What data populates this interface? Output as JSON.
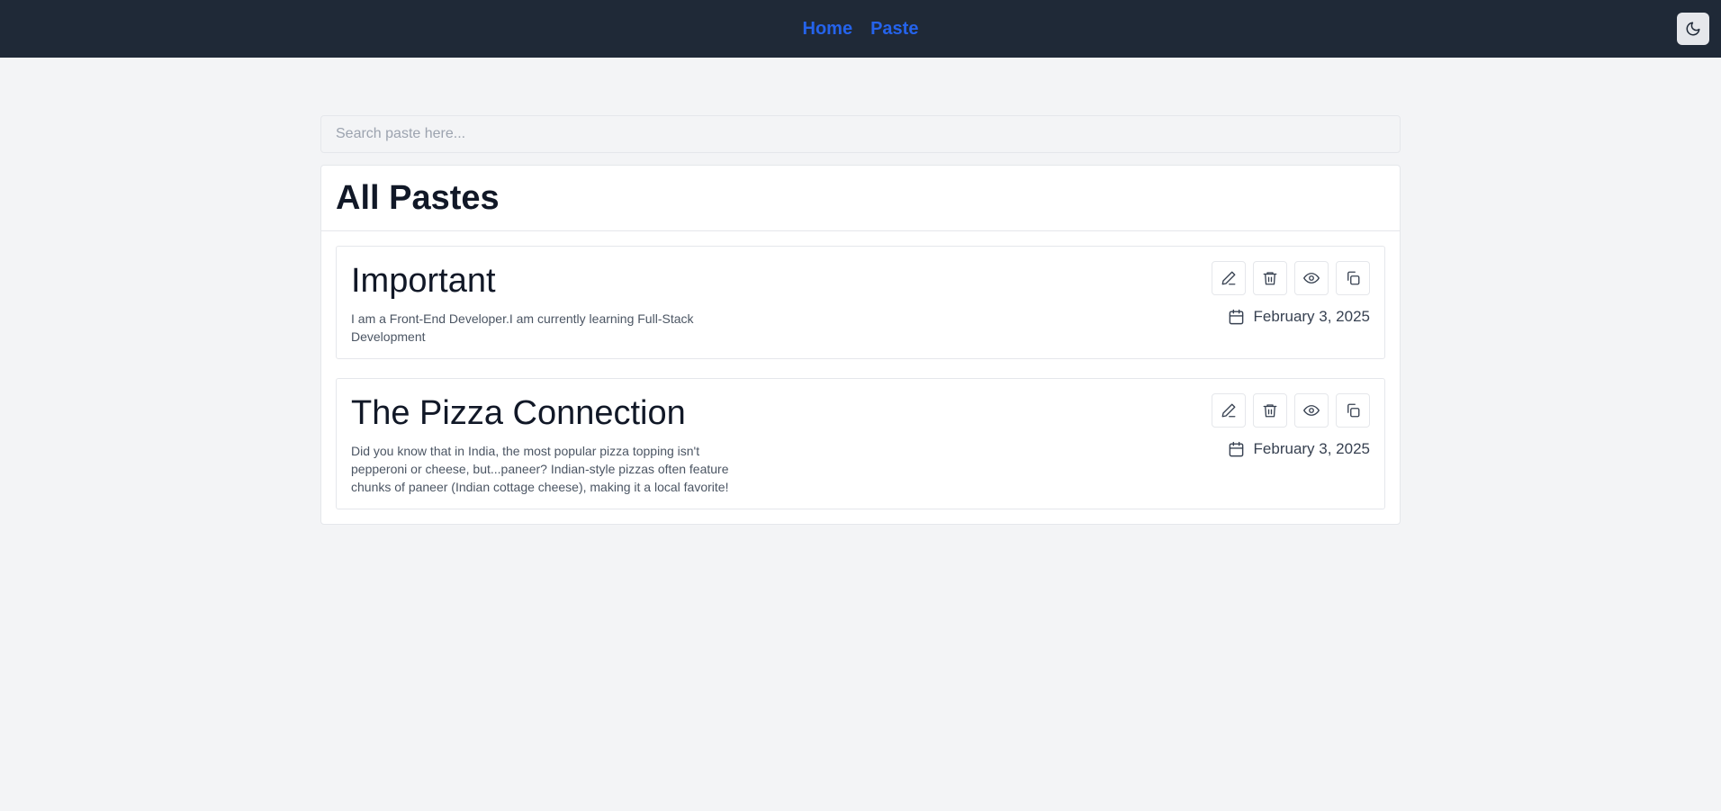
{
  "nav": {
    "links": [
      {
        "label": "Home"
      },
      {
        "label": "Paste"
      }
    ],
    "theme_icon": "moon-icon"
  },
  "search": {
    "placeholder": "Search paste here..."
  },
  "main": {
    "title": "All Pastes",
    "pastes": [
      {
        "title": "Important",
        "content": "I am a Front-End Developer.I am currently learning Full-Stack Development",
        "date": "February 3, 2025"
      },
      {
        "title": "The Pizza Connection",
        "content": "Did you know that in India, the most popular pizza topping isn't pepperoni or cheese, but...paneer? Indian-style pizzas often feature chunks of paneer (Indian cottage cheese), making it a local favorite!",
        "date": "February 3, 2025"
      }
    ],
    "action_icons": [
      "edit-icon",
      "trash-icon",
      "eye-icon",
      "copy-icon"
    ]
  },
  "colors": {
    "navbar": "#1f2937",
    "link": "#2563eb",
    "background": "#f3f4f6"
  }
}
